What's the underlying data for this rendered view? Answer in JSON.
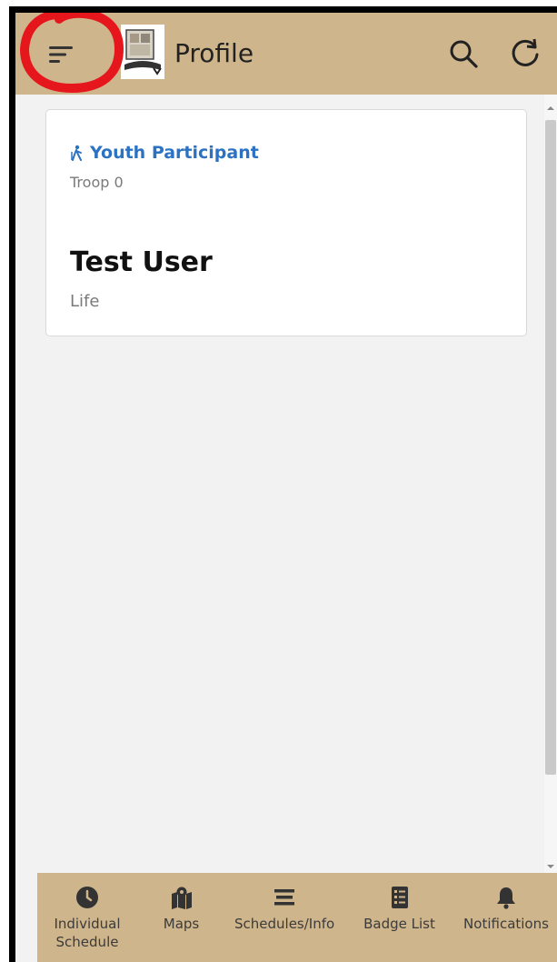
{
  "header": {
    "title": "Profile"
  },
  "profile": {
    "role": "Youth Participant",
    "troop": "Troop 0",
    "name": "Test User",
    "rank": "Life"
  },
  "bottom_nav": {
    "items": [
      {
        "label": "Individual Schedule",
        "icon": "clock-icon"
      },
      {
        "label": "Maps",
        "icon": "map-icon"
      },
      {
        "label": "Schedules/Info",
        "icon": "list-icon"
      },
      {
        "label": "Badge List",
        "icon": "checklist-icon"
      },
      {
        "label": "Notifications",
        "icon": "bell-icon"
      }
    ]
  },
  "colors": {
    "appbar": "#cfb58b",
    "accent_blue": "#2b73c2",
    "annotation_red": "#e5161c"
  }
}
